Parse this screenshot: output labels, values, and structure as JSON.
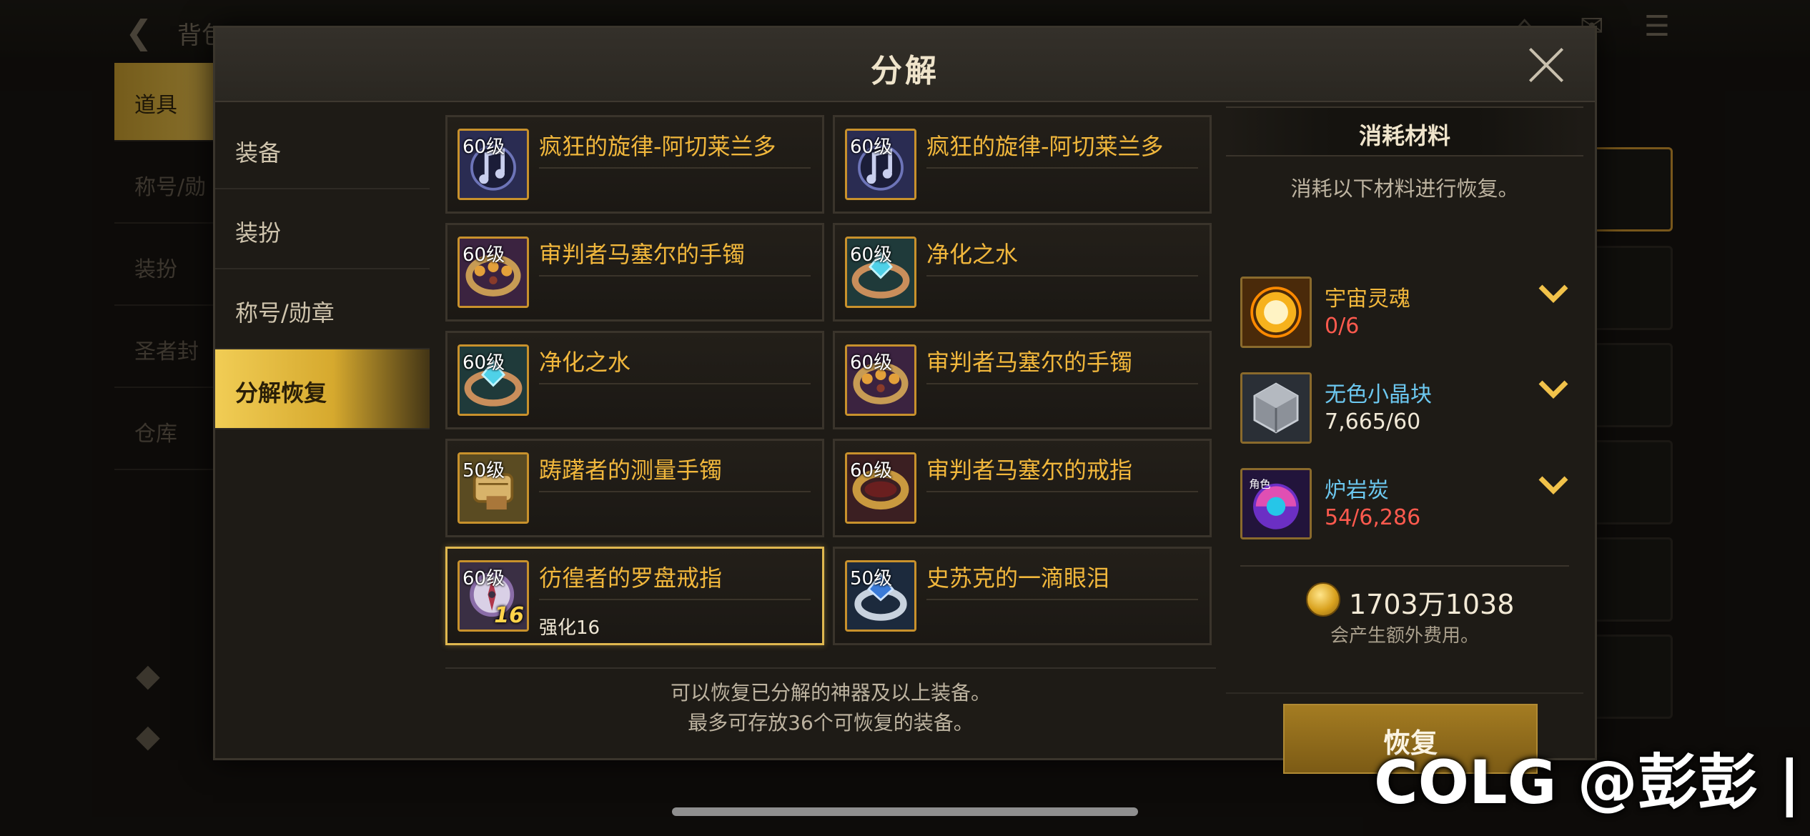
{
  "background": {
    "back_label": "背包",
    "side_items": [
      "道具",
      "称号/勋",
      "装扮",
      "圣者封",
      "仓库"
    ]
  },
  "modal": {
    "title": "分解",
    "tabs": [
      {
        "label": "装备",
        "active": false
      },
      {
        "label": "装扮",
        "active": false
      },
      {
        "label": "称号/勋章",
        "active": false
      },
      {
        "label": "分解恢复",
        "active": true
      }
    ],
    "items": [
      {
        "level": "60级",
        "name": "疯狂的旋律-阿切莱兰多",
        "sub": "",
        "icon": "music-weapon-icon",
        "selected": false
      },
      {
        "level": "60级",
        "name": "疯狂的旋律-阿切莱兰多",
        "sub": "",
        "icon": "music-weapon-icon",
        "selected": false
      },
      {
        "level": "60级",
        "name": "审判者马塞尔的手镯",
        "sub": "",
        "icon": "bracelet-icon",
        "selected": false
      },
      {
        "level": "60级",
        "name": "净化之水",
        "sub": "",
        "icon": "water-gem-icon",
        "selected": false
      },
      {
        "level": "60级",
        "name": "净化之水",
        "sub": "",
        "icon": "water-gem-icon",
        "selected": false
      },
      {
        "level": "60级",
        "name": "审判者马塞尔的手镯",
        "sub": "",
        "icon": "bracelet-icon",
        "selected": false
      },
      {
        "level": "50级",
        "name": "踌躇者的测量手镯",
        "sub": "",
        "icon": "measure-bracelet-icon",
        "selected": false
      },
      {
        "level": "60级",
        "name": "审判者马塞尔的戒指",
        "sub": "",
        "icon": "ring-icon",
        "selected": false
      },
      {
        "level": "60级",
        "name": "彷徨者的罗盘戒指",
        "sub": "强化16",
        "icon": "compass-ring-icon",
        "badge": "16",
        "selected": true
      },
      {
        "level": "50级",
        "name": "史苏克的一滴眼泪",
        "sub": "",
        "icon": "tear-ring-icon",
        "selected": false
      }
    ],
    "footnote_line1": "可以恢复已分解的神器及以上装备。",
    "footnote_line2": "最多可存放36个可恢复的装备。",
    "materials_panel": {
      "title": "消耗材料",
      "description": "消耗以下材料进行恢复。",
      "materials": [
        {
          "name": "宇宙灵魂",
          "count": "0/6",
          "name_color": "#f1b73c",
          "count_color": "#ff5a4e",
          "icon": "cosmic-soul-icon"
        },
        {
          "name": "无色小晶块",
          "count": "7,665/60",
          "name_color": "#6cc8f0",
          "count_color": "#f0e8d6",
          "icon": "colorless-crystal-icon"
        },
        {
          "name": "炉岩炭",
          "count": "54/6,286",
          "name_color": "#6cc8f0",
          "count_color": "#ff5a4e",
          "icon": "furnace-coal-icon"
        }
      ],
      "cost_amount": "1703万1038",
      "cost_note": "会产生额外费用。",
      "restore_label": "恢复"
    }
  },
  "watermark": "COLG @彭彭 |"
}
